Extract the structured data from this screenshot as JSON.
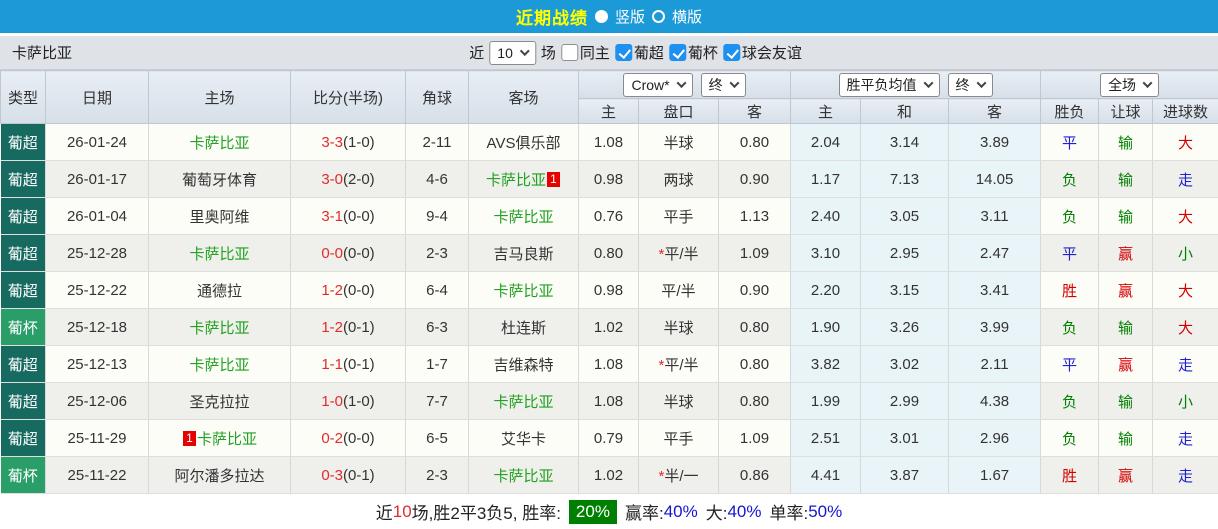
{
  "topbar": {
    "title": "近期战绩",
    "vertical_label": "竖版",
    "horizontal_label": "横版",
    "selected_layout": "竖版"
  },
  "filterbar": {
    "team": "卡萨比亚",
    "near_label": "近",
    "count_value": "10",
    "unit_label": "场",
    "checkboxes": [
      {
        "label": "同主",
        "checked": false
      },
      {
        "label": "葡超",
        "checked": true
      },
      {
        "label": "葡杯",
        "checked": true
      },
      {
        "label": "球会友谊",
        "checked": true
      }
    ]
  },
  "table": {
    "selects": {
      "company": "Crow*",
      "final1": "终",
      "mean": "胜平负均值",
      "final2": "终",
      "scope": "全场"
    },
    "headers": {
      "type": "类型",
      "date": "日期",
      "home": "主场",
      "score": "比分(半场)",
      "corner": "角球",
      "away": "客场",
      "odds_home": "主",
      "handicap": "盘口",
      "odds_away": "客",
      "mean_home": "主",
      "mean_draw": "和",
      "mean_away": "客",
      "result": "胜负",
      "handicap_result": "让球",
      "goals": "进球数"
    },
    "result_color_map": {
      "胜": "red",
      "平": "blue",
      "负": "green",
      "赢": "red",
      "输": "green",
      "大": "red",
      "走": "blue",
      "小": "green"
    },
    "rows": [
      {
        "type": "葡超",
        "league": "super",
        "date": "26-01-24",
        "home": {
          "name": "卡萨比亚",
          "green": true
        },
        "score": "3-3",
        "half": "(1-0)",
        "corner": "2-11",
        "away": {
          "name": "AVS俱乐部",
          "green": false
        },
        "o_home": "1.08",
        "handicap": "半球",
        "o_away": "0.80",
        "m_home": "2.04",
        "m_draw": "3.14",
        "m_away": "3.89",
        "res": "平",
        "hres": "输",
        "gres": "大"
      },
      {
        "type": "葡超",
        "league": "super",
        "date": "26-01-17",
        "home": {
          "name": "葡萄牙体育",
          "green": false
        },
        "score": "3-0",
        "half": "(2-0)",
        "corner": "4-6",
        "away": {
          "name": "卡萨比亚",
          "green": true,
          "badge": "1",
          "badge_pos": "after"
        },
        "o_home": "0.98",
        "handicap": "两球",
        "o_away": "0.90",
        "m_home": "1.17",
        "m_draw": "7.13",
        "m_away": "14.05",
        "res": "负",
        "hres": "输",
        "gres": "走"
      },
      {
        "type": "葡超",
        "league": "super",
        "date": "26-01-04",
        "home": {
          "name": "里奥阿维",
          "green": false
        },
        "score": "3-1",
        "half": "(0-0)",
        "corner": "9-4",
        "away": {
          "name": "卡萨比亚",
          "green": true
        },
        "o_home": "0.76",
        "handicap": "平手",
        "o_away": "1.13",
        "m_home": "2.40",
        "m_draw": "3.05",
        "m_away": "3.11",
        "res": "负",
        "hres": "输",
        "gres": "大"
      },
      {
        "type": "葡超",
        "league": "super",
        "date": "25-12-28",
        "home": {
          "name": "卡萨比亚",
          "green": true
        },
        "score": "0-0",
        "half": "(0-0)",
        "corner": "2-3",
        "away": {
          "name": "吉马良斯",
          "green": false
        },
        "o_home": "0.80",
        "handicap": "*平/半",
        "o_away": "1.09",
        "m_home": "3.10",
        "m_draw": "2.95",
        "m_away": "2.47",
        "res": "平",
        "hres": "赢",
        "gres": "小"
      },
      {
        "type": "葡超",
        "league": "super",
        "date": "25-12-22",
        "home": {
          "name": "通德拉",
          "green": false
        },
        "score": "1-2",
        "half": "(0-0)",
        "corner": "6-4",
        "away": {
          "name": "卡萨比亚",
          "green": true
        },
        "o_home": "0.98",
        "handicap": "平/半",
        "o_away": "0.90",
        "m_home": "2.20",
        "m_draw": "3.15",
        "m_away": "3.41",
        "res": "胜",
        "hres": "赢",
        "gres": "大"
      },
      {
        "type": "葡杯",
        "league": "cup",
        "date": "25-12-18",
        "home": {
          "name": "卡萨比亚",
          "green": true
        },
        "score": "1-2",
        "half": "(0-1)",
        "corner": "6-3",
        "away": {
          "name": "杜连斯",
          "green": false
        },
        "o_home": "1.02",
        "handicap": "半球",
        "o_away": "0.80",
        "m_home": "1.90",
        "m_draw": "3.26",
        "m_away": "3.99",
        "res": "负",
        "hres": "输",
        "gres": "大"
      },
      {
        "type": "葡超",
        "league": "super",
        "date": "25-12-13",
        "home": {
          "name": "卡萨比亚",
          "green": true
        },
        "score": "1-1",
        "half": "(0-1)",
        "corner": "1-7",
        "away": {
          "name": "吉维森特",
          "green": false
        },
        "o_home": "1.08",
        "handicap": "*平/半",
        "o_away": "0.80",
        "m_home": "3.82",
        "m_draw": "3.02",
        "m_away": "2.11",
        "res": "平",
        "hres": "赢",
        "gres": "走"
      },
      {
        "type": "葡超",
        "league": "super",
        "date": "25-12-06",
        "home": {
          "name": "圣克拉拉",
          "green": false
        },
        "score": "1-0",
        "half": "(1-0)",
        "corner": "7-7",
        "away": {
          "name": "卡萨比亚",
          "green": true
        },
        "o_home": "1.08",
        "handicap": "半球",
        "o_away": "0.80",
        "m_home": "1.99",
        "m_draw": "2.99",
        "m_away": "4.38",
        "res": "负",
        "hres": "输",
        "gres": "小"
      },
      {
        "type": "葡超",
        "league": "super",
        "date": "25-11-29",
        "home": {
          "name": "卡萨比亚",
          "green": true,
          "badge": "1",
          "badge_pos": "before"
        },
        "score": "0-2",
        "half": "(0-0)",
        "corner": "6-5",
        "away": {
          "name": "艾华卡",
          "green": false
        },
        "o_home": "0.79",
        "handicap": "平手",
        "o_away": "1.09",
        "m_home": "2.51",
        "m_draw": "3.01",
        "m_away": "2.96",
        "res": "负",
        "hres": "输",
        "gres": "走"
      },
      {
        "type": "葡杯",
        "league": "cup",
        "date": "25-11-22",
        "home": {
          "name": "阿尔潘多拉达",
          "green": false
        },
        "score": "0-3",
        "half": "(0-1)",
        "corner": "2-3",
        "away": {
          "name": "卡萨比亚",
          "green": true
        },
        "o_home": "1.02",
        "handicap": "*半/一",
        "o_away": "0.86",
        "m_home": "4.41",
        "m_draw": "3.87",
        "m_away": "1.67",
        "res": "胜",
        "hres": "赢",
        "gres": "走"
      }
    ]
  },
  "footer": {
    "near_label": "近",
    "count": "10",
    "summary": "场,胜2平3负5, 胜率:",
    "win_rate": "20%",
    "segments": [
      {
        "label": "赢率:",
        "value": "40%"
      },
      {
        "label": "大:",
        "value": "40%"
      },
      {
        "label": "单率:",
        "value": "50%"
      }
    ]
  },
  "colors": {
    "topbar_bg": "#1b9ad7",
    "title_yellow": "#ffff00",
    "league_super_bg": "#176a60",
    "league_cup_bg": "#2a9e68",
    "team_green": "#22a122",
    "score_red": "#e22b2b",
    "result_red": "#d40000",
    "result_blue": "#2020cc",
    "result_green": "#008000",
    "mean_col_bg": "#e9f4f9",
    "win_badge_bg": "#008000",
    "checkbox_blue": "#1e90f0"
  }
}
